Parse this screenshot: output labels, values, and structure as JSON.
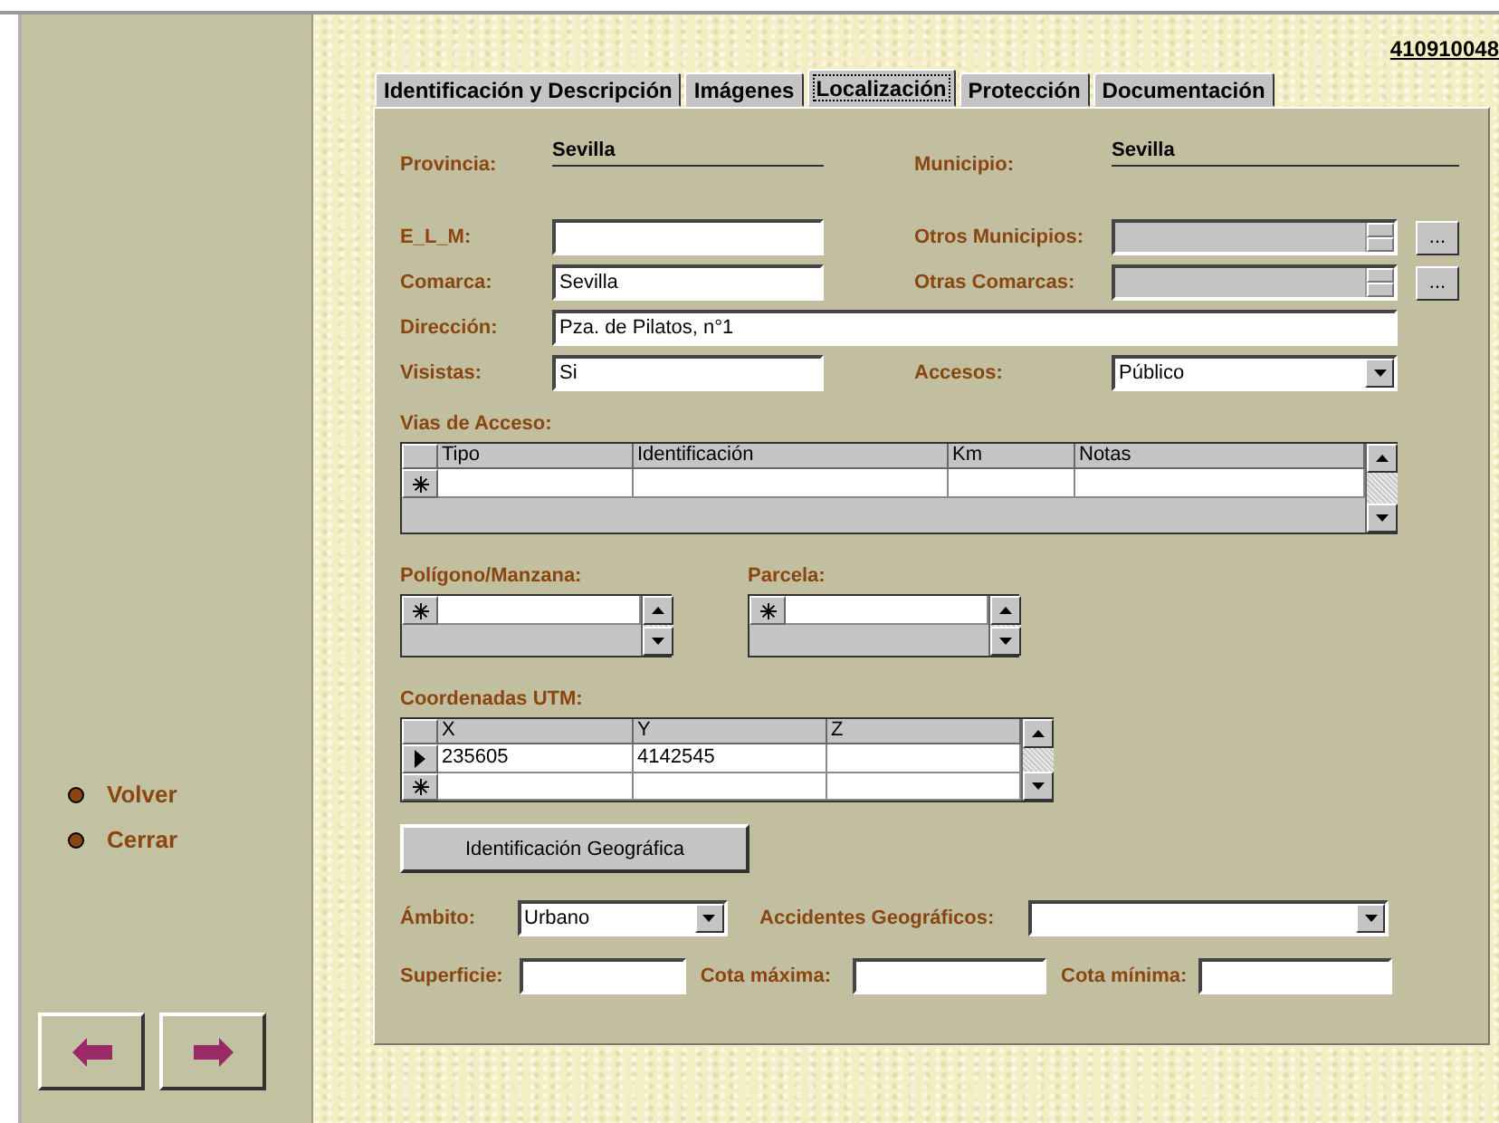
{
  "record_id": "410910048",
  "tabs": [
    {
      "label": "Identificación y Descripción",
      "selected": false
    },
    {
      "label": "Imágenes",
      "selected": false
    },
    {
      "label": "Localización",
      "selected": true
    },
    {
      "label": "Protección",
      "selected": false
    },
    {
      "label": "Documentación",
      "selected": false
    }
  ],
  "header_fields": [
    {
      "label": "Provincia:",
      "value": "Sevilla"
    },
    {
      "label": "Municipio:",
      "value": "Sevilla"
    }
  ],
  "form_rows": [
    [
      {
        "kind": "text",
        "label": "E_L_M:"
      },
      {
        "kind": "list",
        "label": "Otros Municipios:",
        "button": "..."
      }
    ],
    [
      {
        "kind": "text",
        "label": "Comarca:",
        "value": "Sevilla"
      },
      {
        "kind": "list",
        "label": "Otras Comarcas:",
        "button": "..."
      }
    ],
    [
      {
        "kind": "wide",
        "label": "Dirección:",
        "value": "Pza. de Pilatos, n°1"
      }
    ],
    [
      {
        "kind": "text",
        "label": "Visistas:",
        "value": "Si"
      },
      {
        "kind": "combo",
        "label": "Accesos:",
        "value": "Público"
      }
    ]
  ],
  "vias_de_acceso": {
    "label": "Vias de Acceso:",
    "columns": [
      "Tipo",
      "Identificación",
      "Km",
      "Notas"
    ]
  },
  "small_grids": [
    {
      "label": "Polígono/Manzana:"
    },
    {
      "label": "Parcela:"
    }
  ],
  "coordenadas": {
    "label": "Coordenadas UTM:",
    "columns": [
      "X",
      "Y",
      "Z"
    ],
    "rows": [
      {
        "cells": [
          "235605",
          "4142545"
        ],
        "selected": true
      }
    ]
  },
  "geo_button": "Identificación Geográfica",
  "bottom_rows": [
    [
      {
        "kind": "combo",
        "label": "Ámbito:",
        "value": "Urbano"
      },
      {
        "kind": "combo",
        "label": "Accidentes Geográficos:"
      }
    ],
    [
      {
        "kind": "text",
        "label": "Superficie:"
      },
      {
        "kind": "text",
        "label": "Cota máxima:"
      },
      {
        "kind": "text",
        "label": "Cota mínima:"
      }
    ]
  ],
  "sidebar_links": [
    "Volver",
    "Cerrar"
  ]
}
